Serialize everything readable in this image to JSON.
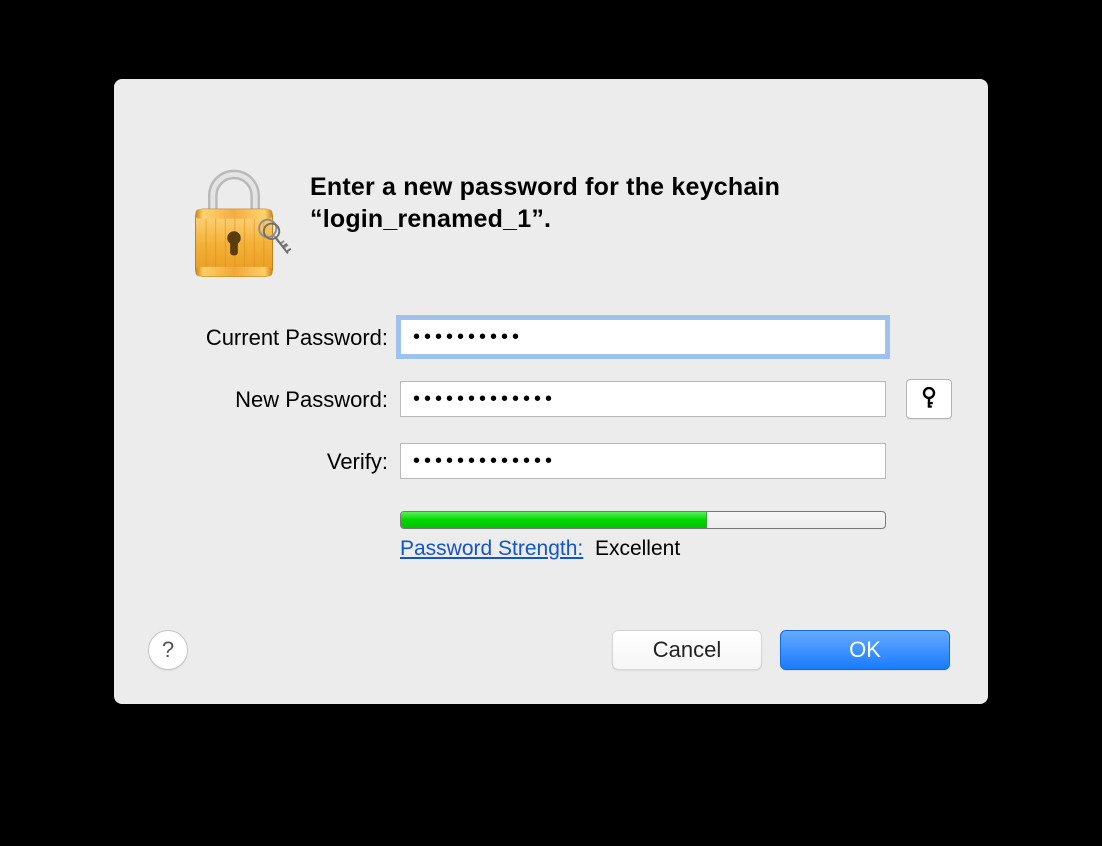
{
  "heading": "Enter a new password for the keychain “login_renamed_1”.",
  "labels": {
    "current": "Current Password:",
    "new": "New Password:",
    "verify": "Verify:"
  },
  "fields": {
    "current_value": "••••••••••",
    "new_value": "•••••••••••••",
    "verify_value": "•••••••••••••"
  },
  "strength": {
    "label": "Password Strength:",
    "value": "Excellent",
    "percent": 63
  },
  "buttons": {
    "help": "?",
    "cancel": "Cancel",
    "ok": "OK"
  }
}
